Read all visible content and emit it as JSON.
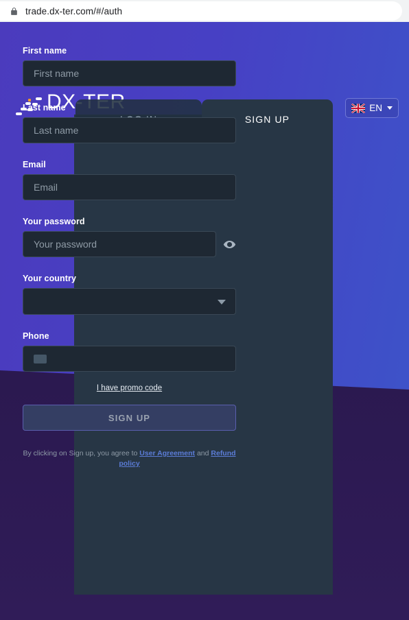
{
  "browser": {
    "url": "trade.dx-ter.com/#/auth",
    "lock_icon": "lock-icon"
  },
  "brand": {
    "name": "DX-TER",
    "mark_icon": "particles-logo-icon"
  },
  "language": {
    "code": "EN",
    "flag_icon": "uk-flag-icon",
    "caret_icon": "chevron-down-icon"
  },
  "tabs": [
    {
      "id": "login",
      "label": "LOG IN",
      "active": false
    },
    {
      "id": "signup",
      "label": "SIGN UP",
      "active": true
    }
  ],
  "form": {
    "first_name": {
      "label": "First name",
      "placeholder": "First name",
      "value": ""
    },
    "last_name": {
      "label": "Last name",
      "placeholder": "Last name",
      "value": ""
    },
    "email": {
      "label": "Email",
      "placeholder": "Email",
      "value": ""
    },
    "password": {
      "label": "Your password",
      "placeholder": "Your password",
      "value": "",
      "toggle_icon": "eye-icon"
    },
    "country": {
      "label": "Your country",
      "value": "",
      "caret_icon": "chevron-down-icon"
    },
    "phone": {
      "label": "Phone",
      "value": "",
      "flag_icon": "country-flag-placeholder-icon"
    },
    "promo_link": "I have promo code",
    "submit_label": "SIGN UP",
    "terms": {
      "prefix": "By clicking on Sign up, you agree to ",
      "user_agreement": "User Agreement",
      "conjunction": " and ",
      "refund_policy": "Refund policy"
    }
  },
  "colors": {
    "card_bg": "#273645",
    "input_bg": "#1e2833",
    "accent_blue": "#5b7cd6",
    "bg_gradient_start": "#4b3bbd",
    "bg_gradient_end": "#3d53c9",
    "bg_bottom": "#2c1a56",
    "logo_accent": "#f2962c"
  }
}
